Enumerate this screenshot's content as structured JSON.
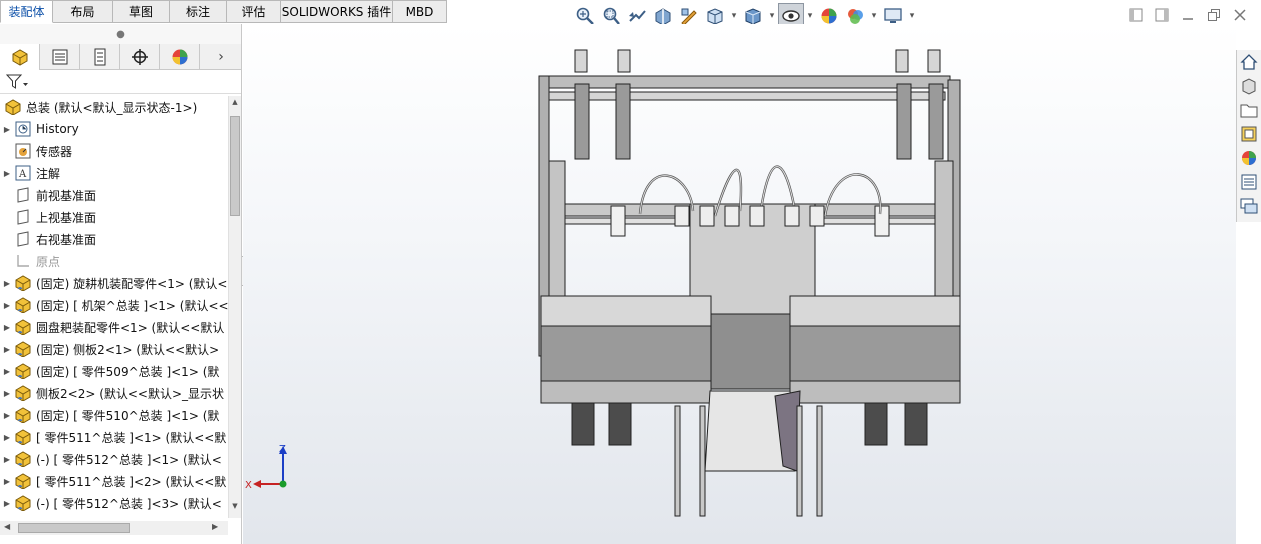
{
  "command_tabs": [
    {
      "label": "装配体",
      "active": true
    },
    {
      "label": "布局",
      "active": false
    },
    {
      "label": "草图",
      "active": false
    },
    {
      "label": "标注",
      "active": false
    },
    {
      "label": "评估",
      "active": false
    },
    {
      "label": "SOLIDWORKS 插件",
      "active": false
    },
    {
      "label": "MBD",
      "active": false
    }
  ],
  "view_toolbar": [
    "zoom-to-fit-icon",
    "zoom-to-area-icon",
    "previous-view-icon",
    "section-view-icon",
    "dynamic-annotation-icon",
    "view-orientation-icon",
    "display-style-icon",
    "hide-show-items-icon",
    "edit-appearance-icon",
    "apply-scene-icon",
    "view-settings-icon"
  ],
  "panel_tabs": [
    "featuremanager-icon",
    "propertymanager-icon",
    "configurationmanager-icon",
    "dimxpert-icon",
    "displaymanager-icon"
  ],
  "tree": {
    "root": "总装  (默认<默认_显示状态-1>)",
    "items": [
      {
        "label": "History",
        "icon": "history-icon",
        "expandable": true,
        "dim": false
      },
      {
        "label": "传感器",
        "icon": "sensor-icon",
        "expandable": false,
        "dim": false
      },
      {
        "label": "注解",
        "icon": "annotation-icon",
        "expandable": true,
        "dim": false
      },
      {
        "label": "前视基准面",
        "icon": "plane-icon",
        "expandable": false,
        "dim": false
      },
      {
        "label": "上视基准面",
        "icon": "plane-icon",
        "expandable": false,
        "dim": false
      },
      {
        "label": "右视基准面",
        "icon": "plane-icon",
        "expandable": false,
        "dim": false
      },
      {
        "label": "原点",
        "icon": "origin-icon",
        "expandable": false,
        "dim": true
      },
      {
        "label": "(固定) 旋耕机装配零件<1> (默认<",
        "icon": "subassembly-icon",
        "expandable": true,
        "dim": false
      },
      {
        "label": "(固定) [ 机架^总装 ]<1> (默认<<",
        "icon": "subassembly-icon",
        "expandable": true,
        "dim": false
      },
      {
        "label": "圆盘耙装配零件<1> (默认<<默认",
        "icon": "subassembly-icon",
        "expandable": true,
        "dim": false
      },
      {
        "label": "(固定) 侧板2<1> (默认<<默认>",
        "icon": "subassembly-icon",
        "expandable": true,
        "dim": false
      },
      {
        "label": "(固定) [ 零件509^总装 ]<1> (默",
        "icon": "subassembly-icon",
        "expandable": true,
        "dim": false
      },
      {
        "label": "侧板2<2> (默认<<默认>_显示状",
        "icon": "subassembly-icon",
        "expandable": true,
        "dim": false
      },
      {
        "label": "(固定) [ 零件510^总装 ]<1> (默",
        "icon": "subassembly-icon",
        "expandable": true,
        "dim": false
      },
      {
        "label": "[ 零件511^总装 ]<1> (默认<<默",
        "icon": "subassembly-icon",
        "expandable": true,
        "dim": false
      },
      {
        "label": "(-) [ 零件512^总装 ]<1> (默认<",
        "icon": "subassembly-icon",
        "expandable": true,
        "dim": false
      },
      {
        "label": "[ 零件511^总装 ]<2> (默认<<默",
        "icon": "subassembly-icon",
        "expandable": true,
        "dim": false
      },
      {
        "label": "(-) [ 零件512^总装 ]<3> (默认<",
        "icon": "subassembly-icon",
        "expandable": true,
        "dim": false
      }
    ]
  },
  "triad": {
    "z_label": "Z",
    "x_label": "X"
  },
  "task_pane": [
    "home-icon",
    "design-library-icon",
    "file-explorer-icon",
    "view-palette-icon",
    "appearances-icon",
    "custom-properties-icon",
    "forum-icon"
  ],
  "colors": {
    "accent": "#0b4fa8",
    "model_gray": "#8e8e8e",
    "model_dark": "#4a4a4a",
    "tab_bg": "#ececec"
  }
}
